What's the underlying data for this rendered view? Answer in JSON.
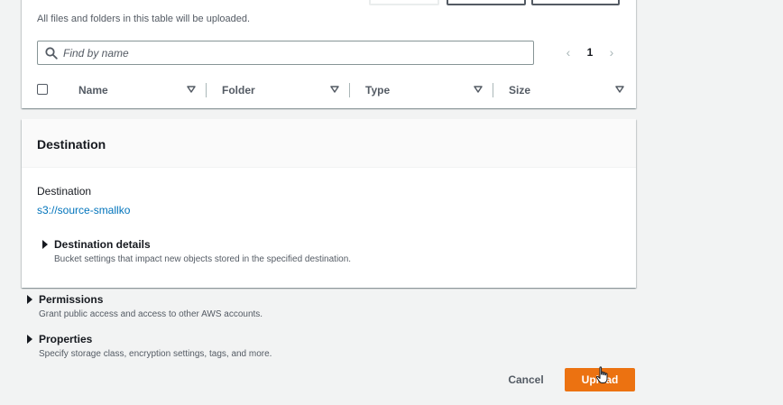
{
  "files": {
    "note": "All files and folders in this table will be uploaded.",
    "search": {
      "placeholder": "Find by name",
      "value": ""
    },
    "pagination": {
      "current_page": "1"
    },
    "columns": [
      "Name",
      "Folder",
      "Type",
      "Size"
    ]
  },
  "destination": {
    "title": "Destination",
    "label": "Destination",
    "uri": "s3://source-smallko",
    "details": {
      "title": "Destination details",
      "description": "Bucket settings that impact new objects stored in the specified destination."
    }
  },
  "permissions": {
    "title": "Permissions",
    "description": "Grant public access and access to other AWS accounts."
  },
  "properties": {
    "title": "Properties",
    "description": "Specify storage class, encryption settings, tags, and more."
  },
  "actions": {
    "cancel_label": "Cancel",
    "upload_label": "Upload"
  },
  "colors": {
    "primary": "#ec7211",
    "link": "#0073bb",
    "text": "#16191f",
    "muted": "#545b64",
    "background": "#f2f3f3"
  },
  "icons": {
    "search": "search-icon",
    "sort": "caret-down-icon",
    "expand": "caret-right-icon",
    "prev": "chevron-left-icon",
    "next": "chevron-right-icon",
    "cursor": "hand-pointer-icon"
  }
}
